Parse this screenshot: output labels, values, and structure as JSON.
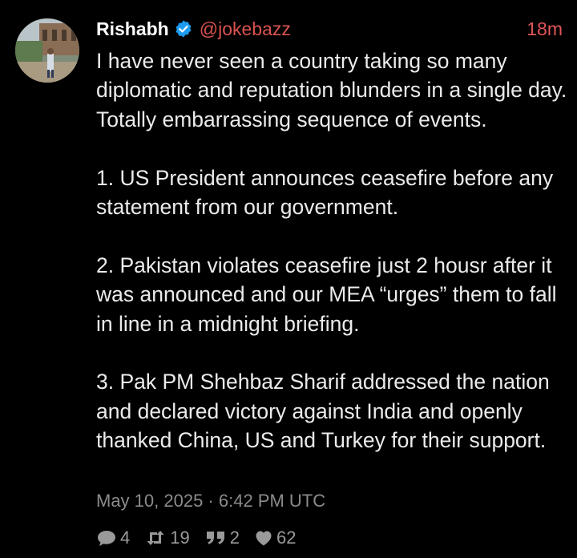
{
  "tweet": {
    "author": {
      "display_name": "Rishabh",
      "handle": "@jokebazz",
      "verified": true,
      "avatar_icon": "profile-photo"
    },
    "time_ago": "18m",
    "paragraphs": [
      "I have never seen a country taking so many diplomatic and reputation blunders in a single day. Totally embarrassing sequence of events.",
      "1. US President announces ceasefire before any statement from our government.",
      "2. Pakistan violates ceasefire just 2 housr after it was announced and our MEA “urges” them to fall in line in a midnight briefing.",
      "3. Pak PM Shehbaz Sharif addressed the nation and declared victory against India and openly thanked China, US and Turkey for their support."
    ],
    "timestamp": "May 10, 2025 · 6:42 PM UTC",
    "stats": {
      "replies": "4",
      "retweets": "19",
      "quotes": "2",
      "likes": "62"
    }
  },
  "colors": {
    "background": "#000000",
    "text": "#ebebeb",
    "handle": "#d9534f",
    "time_ago": "#e0555a",
    "muted": "#8b8b8b",
    "verified": "#1d9bf0"
  }
}
